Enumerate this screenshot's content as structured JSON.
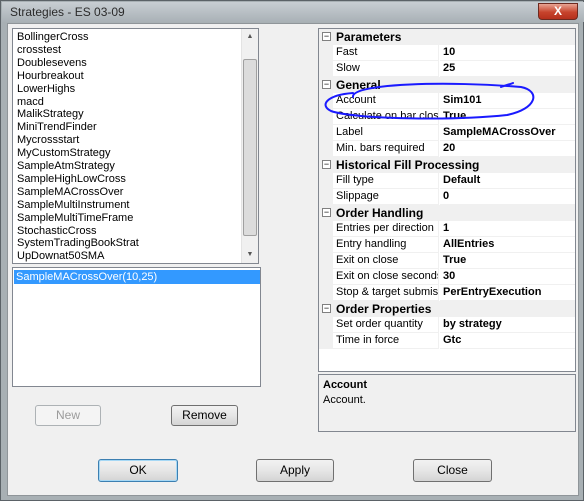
{
  "window": {
    "title": "Strategies - ES 03-09",
    "close_glyph": "X"
  },
  "strategy_list": {
    "items": [
      "BollingerCross",
      "crosstest",
      "Doublesevens",
      "Hourbreakout",
      "LowerHighs",
      "macd",
      "MalikStrategy",
      "MiniTrendFinder",
      "Mycrossstart",
      "MyCustomStrategy",
      "SampleAtmStrategy",
      "SampleHighLowCross",
      "SampleMACrossOver",
      "SampleMultiInstrument",
      "SampleMultiTimeFrame",
      "StochasticCross",
      "SystemTradingBookStrat",
      "UpDownat50SMA"
    ]
  },
  "instance_list": {
    "items": [
      "SampleMACrossOver(10,25)"
    ]
  },
  "buttons": {
    "new": "New",
    "remove": "Remove",
    "ok": "OK",
    "apply": "Apply",
    "close": "Close"
  },
  "property_grid": {
    "toggle_glyph": "−",
    "rows": [
      {
        "type": "category",
        "label": "Parameters"
      },
      {
        "type": "property",
        "name": "Fast",
        "value": "10"
      },
      {
        "type": "property",
        "name": "Slow",
        "value": "25"
      },
      {
        "type": "category",
        "label": "General"
      },
      {
        "type": "property",
        "name": "Account",
        "value": "Sim101"
      },
      {
        "type": "property",
        "name": "Calculate on bar close",
        "value": "True"
      },
      {
        "type": "property",
        "name": "Label",
        "value": "SampleMACrossOver"
      },
      {
        "type": "property",
        "name": "Min. bars required",
        "value": "20"
      },
      {
        "type": "category",
        "label": "Historical Fill Processing"
      },
      {
        "type": "property",
        "name": "Fill type",
        "value": "Default"
      },
      {
        "type": "property",
        "name": "Slippage",
        "value": "0"
      },
      {
        "type": "category",
        "label": "Order Handling"
      },
      {
        "type": "property",
        "name": "Entries per direction",
        "value": "1"
      },
      {
        "type": "property",
        "name": "Entry handling",
        "value": "AllEntries"
      },
      {
        "type": "property",
        "name": "Exit on close",
        "value": "True"
      },
      {
        "type": "property",
        "name": "Exit on close seconds",
        "value": "30"
      },
      {
        "type": "property",
        "name": "Stop & target submission",
        "value": "PerEntryExecution"
      },
      {
        "type": "category",
        "label": "Order Properties"
      },
      {
        "type": "property",
        "name": "Set order quantity",
        "value": "by strategy"
      },
      {
        "type": "property",
        "name": "Time in force",
        "value": "Gtc"
      }
    ]
  },
  "description": {
    "title": "Account",
    "text": "Account."
  },
  "colors": {
    "selection": "#3399ff",
    "annotation": "#1a1aff"
  }
}
